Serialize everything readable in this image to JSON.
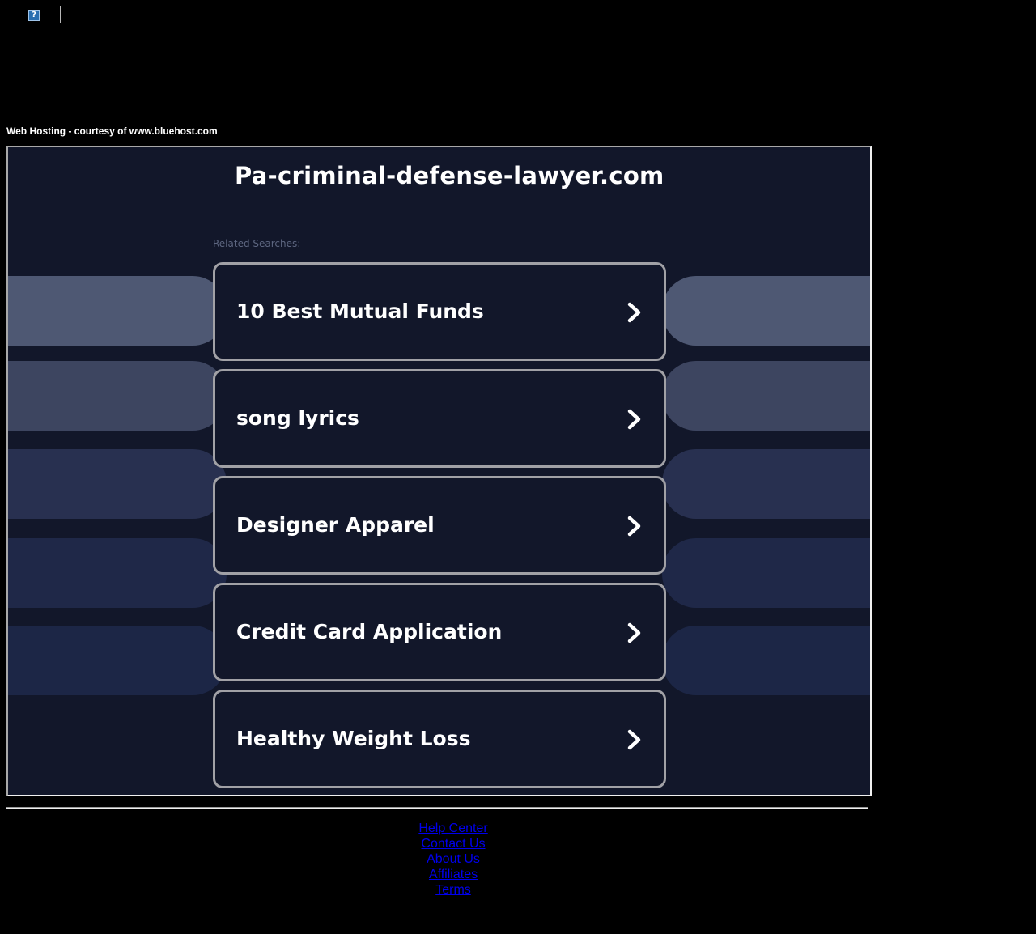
{
  "top_banner": {
    "icon": "broken-image-icon",
    "glyph": "?"
  },
  "courtesy_text": "Web Hosting - courtesy of www.bluehost.com",
  "main": {
    "domain_title": "Pa-criminal-defense-lawyer.com",
    "related_label": "Related Searches:",
    "searches": [
      {
        "label": "10 Best Mutual Funds",
        "icon": "chevron-right-icon"
      },
      {
        "label": "song lyrics",
        "icon": "chevron-right-icon"
      },
      {
        "label": "Designer Apparel",
        "icon": "chevron-right-icon"
      },
      {
        "label": "Credit Card Application",
        "icon": "chevron-right-icon"
      },
      {
        "label": "Healthy Weight Loss",
        "icon": "chevron-right-icon"
      }
    ]
  },
  "footer": {
    "links": [
      "Help Center",
      "Contact Us",
      "About Us",
      "Affiliates",
      "Terms"
    ]
  },
  "colors": {
    "page_background": "#000000",
    "frame_background": "#12172a",
    "card_border": "#a1a1a6",
    "related_label": "#5d6680",
    "link": "#0000ee",
    "pill_shades": [
      "#4e5873",
      "#3d4560",
      "#283050",
      "#1f2848",
      "#1c2646"
    ]
  }
}
